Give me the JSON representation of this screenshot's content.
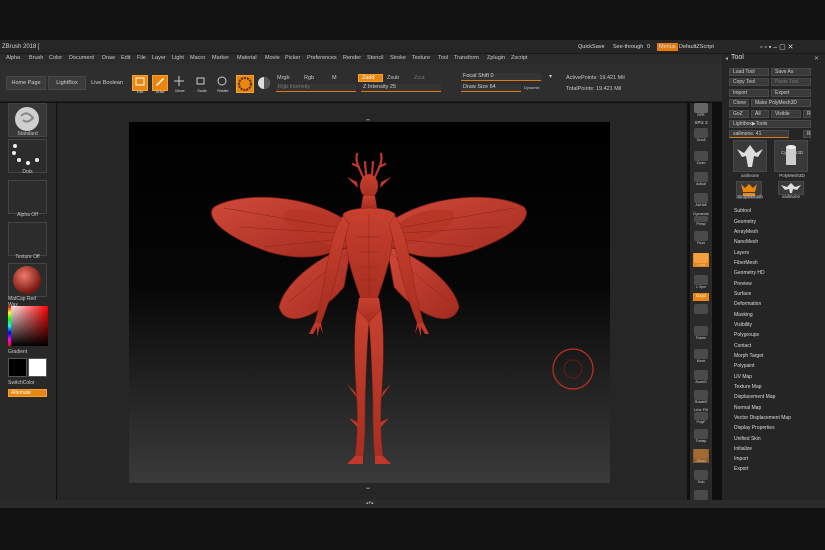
{
  "title": "ZBrush 2018 [",
  "top_right": {
    "quicksave": "QuickSave",
    "see_through_label": "See-through",
    "see_through_value": "0",
    "menus": "Menus",
    "default_zscript": "DefaultZScript"
  },
  "menu_items": [
    "Alpha",
    "Brush",
    "Color",
    "Document",
    "Draw",
    "Edit",
    "File",
    "Layer",
    "Light",
    "Macro",
    "Marker",
    "Material",
    "Movie",
    "Picker",
    "Preferences",
    "Render",
    "Stencil",
    "Stroke",
    "Texture",
    "Tool",
    "Transform",
    "Zplugin",
    "Zscript"
  ],
  "shelf": {
    "home_page": "Home Page",
    "lightbox": "LightBox",
    "live_boolean": "Live Boolean",
    "tools": [
      {
        "label": "Edit",
        "active": true
      },
      {
        "label": "Draw",
        "active": true
      },
      {
        "label": "Move",
        "active": false
      },
      {
        "label": "Scale",
        "active": false
      },
      {
        "label": "Rotate",
        "active": false
      }
    ],
    "mrgb": "Mrgb",
    "rgb": "Rgb",
    "m": "M",
    "rgb_intensity": "Rgb Intensity",
    "zadd": "Zadd",
    "zsub": "Zsub",
    "zcut": "Zcut",
    "z_intensity_label": "Z Intensity",
    "z_intensity_value": "25",
    "focal_shift_label": "Focal Shift",
    "focal_shift_value": "0",
    "draw_size_label": "Draw Size",
    "draw_size_value": "64",
    "dynamic": "Dynamic",
    "active_points": "ActivePoints: 19.421 Mil",
    "total_points": "TotalPoints: 19.421 Mil"
  },
  "left_shelf": {
    "standard": "Standard",
    "dots": "Dots",
    "alpha_off": "Alpha Off",
    "texture_off": "Texture Off",
    "matcap": "MatCap Red Wax",
    "gradient": "Gradient",
    "switch_color": "SwitchColor",
    "alternate": "Alternate"
  },
  "right_shelf": [
    "BPR",
    "SPix 3",
    "Scroll",
    "Zoom",
    "Actual",
    "AAHalf",
    "Dynamic",
    "Persp",
    "Floor",
    "Local",
    "L.Sym",
    "Gxyz",
    "",
    "Frame",
    "Move",
    "ZoomD",
    "RotateD",
    "Line Fill",
    "PolyF",
    "Transp",
    "Ghost",
    "Solo",
    "Xpose"
  ],
  "tool_palette": {
    "title": "Tool",
    "load_tool": "Load Tool",
    "save_as": "Save As",
    "copy_tool": "Copy Tool",
    "paste_tool": "Paste Tool",
    "import": "Import",
    "export": "Export",
    "clone": "Clone",
    "make_polymesh": "Make PolyMesh3D",
    "goz": "GoZ",
    "all": "All",
    "visible": "Visible",
    "r": "R",
    "lightbox_tools": "Lightbox▶Tools",
    "tool_name": "xailmone.",
    "tool_value": "41",
    "thumbs": [
      "xailmone",
      "Cylinder3D",
      "PolyMesh3D",
      "SimpleBrush",
      "xailmone"
    ],
    "subpalettes": [
      "Subtool",
      "Geometry",
      "ArrayMesh",
      "NanoMesh",
      "Layers",
      "FiberMesh",
      "Geometry HD",
      "Preview",
      "Surface",
      "Deformation",
      "Masking",
      "Visibility",
      "Polygroups",
      "Contact",
      "Morph Target",
      "Polypaint",
      "UV Map",
      "Texture Map",
      "Displacement Map",
      "Normal Map",
      "Vector Displacement Map",
      "Display Properties",
      "Unified Skin",
      "Initialize",
      "Import",
      "Export"
    ]
  },
  "colors": {
    "accent": "#e8860f",
    "model": "#c0382a"
  }
}
